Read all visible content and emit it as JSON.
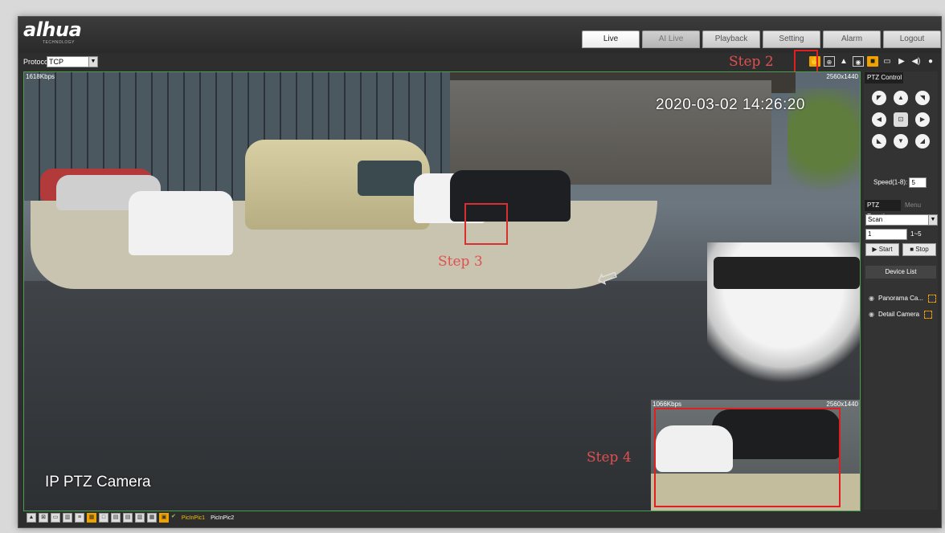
{
  "header": {
    "logo": "alhua",
    "logo_sub": "TECHNOLOGY",
    "tabs": [
      "Live",
      "AI Live",
      "Playback",
      "Setting",
      "Alarm",
      "Logout"
    ],
    "active_tab": "Live"
  },
  "toolbar": {
    "protocol_label": "Protocol",
    "protocol_value": "TCP",
    "step2": "Step 2",
    "icons": [
      "ptz-hand-icon",
      "zoom-icon",
      "person-icon",
      "fisheye-icon",
      "record-icon",
      "snapshot-icon",
      "video-icon",
      "volume-icon",
      "mic-icon"
    ]
  },
  "video": {
    "bitrate": "1618Kbps",
    "resolution": "2560x1440",
    "timestamp": "2020-03-02 14:26:20",
    "camera_label": "IP PTZ Camera",
    "step3": "Step 3"
  },
  "pip": {
    "bitrate": "1066Kbps",
    "resolution": "2560x1440",
    "step4": "Step 4"
  },
  "ptz": {
    "tab_control": "PTZ Control",
    "speed_label": "Speed(1-8):",
    "speed_value": "5",
    "tab_function": "PTZ Function",
    "tab_menu": "Menu",
    "function_value": "Scan",
    "number_value": "1",
    "range": "1~5",
    "start": "Start",
    "stop": "Stop"
  },
  "device_list": {
    "title": "Device List",
    "items": [
      "Panorama Ca...",
      "Detail Camera"
    ]
  },
  "bottom": {
    "pic1": "PicInPic1",
    "pic2": "PicInPic2"
  }
}
